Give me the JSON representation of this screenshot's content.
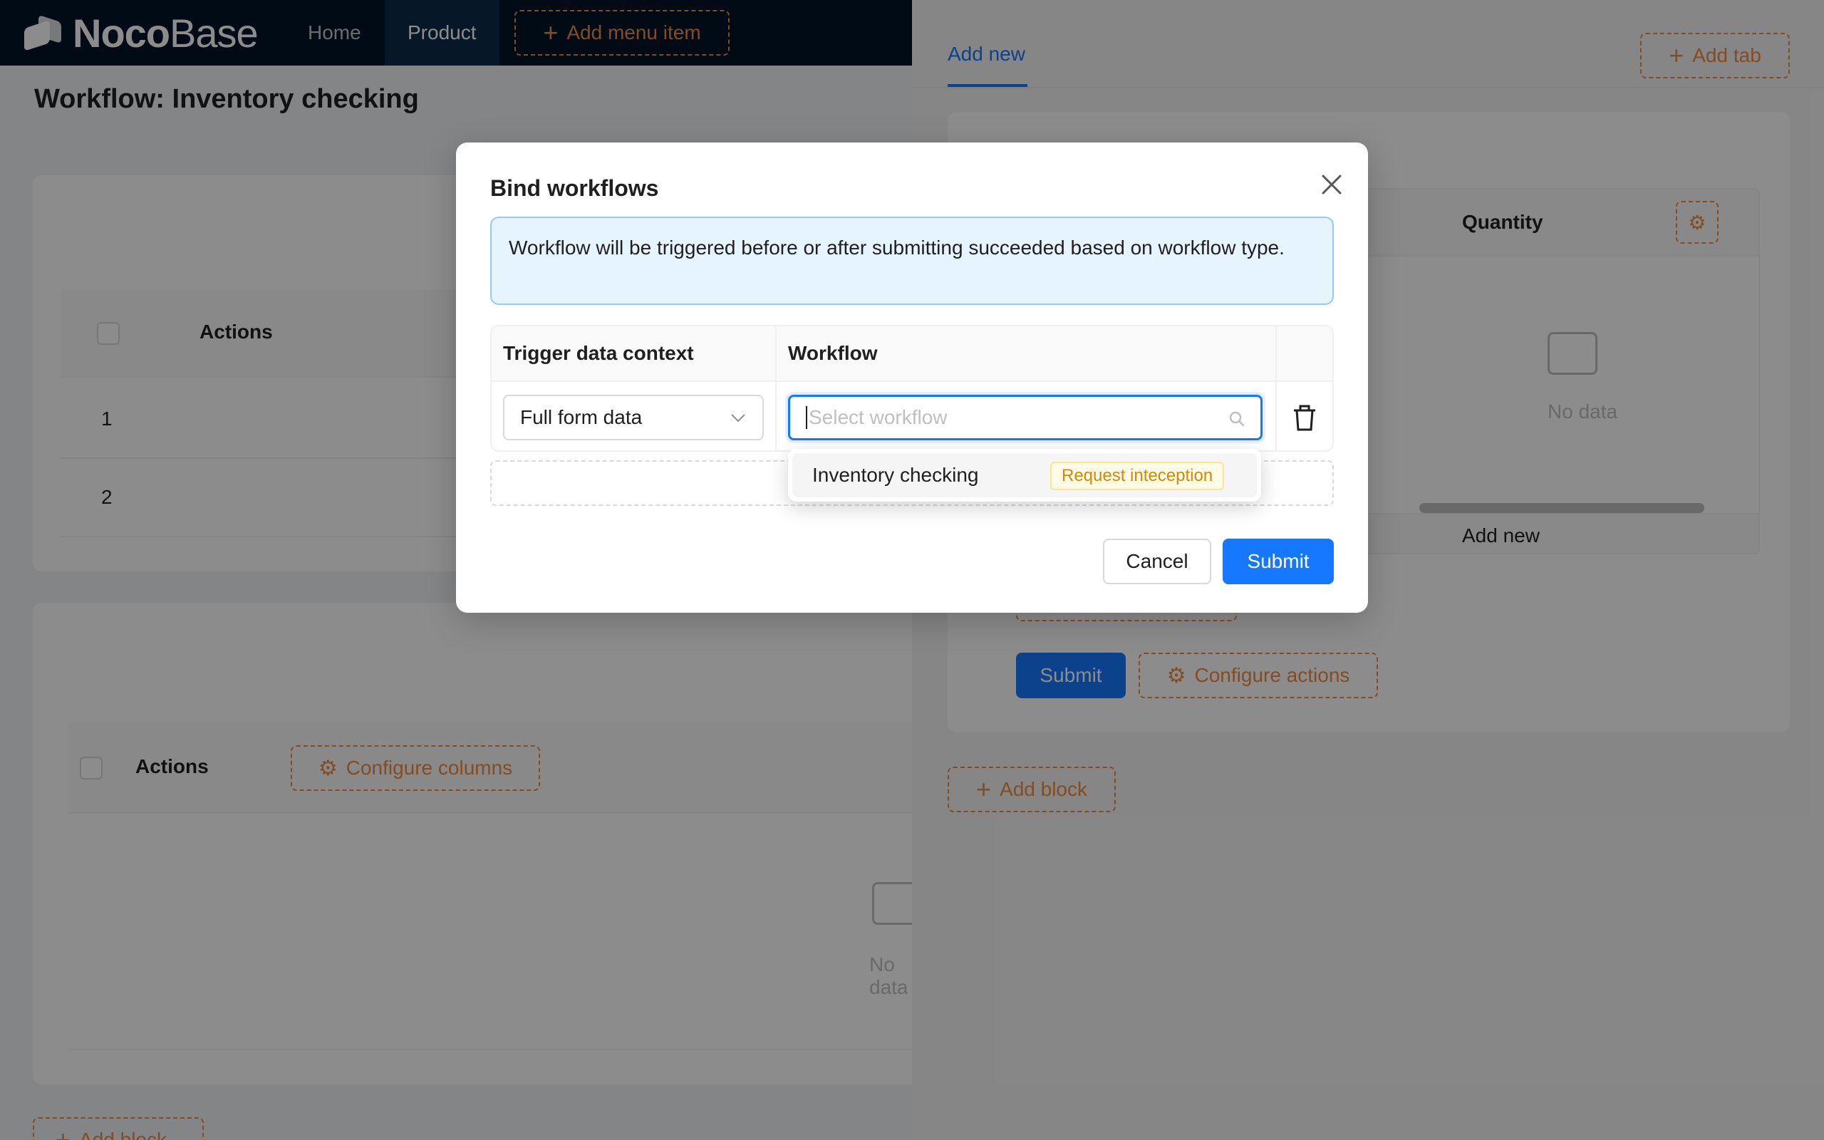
{
  "app": {
    "logo_bold": "Noco",
    "logo_light": "Base"
  },
  "nav": {
    "home": "Home",
    "product": "Product",
    "add_menu_item": "Add menu item"
  },
  "page": {
    "title": "Workflow: Inventory checking",
    "table1": {
      "actions_header": "Actions",
      "rows": [
        "1",
        "2"
      ]
    },
    "table2": {
      "actions_header": "Actions",
      "configure_columns": "Configure columns",
      "empty_text": "No data"
    },
    "add_block": "Add block"
  },
  "drawer": {
    "tab_add_new": "Add new",
    "add_tab": "Add tab",
    "inner_header": "Quantity",
    "inner_empty": "No data",
    "inner_footer": "Add new",
    "submit": "Submit",
    "configure_actions": "Configure actions",
    "add_block": "Add block"
  },
  "modal": {
    "title": "Bind workflows",
    "alert": "Workflow will be triggered before or after submitting succeeded based on workflow type.",
    "col_trigger": "Trigger data context",
    "col_workflow": "Workflow",
    "context_value": "Full form data",
    "workflow_placeholder": "Select workflow",
    "cancel": "Cancel",
    "submit": "Submit"
  },
  "dropdown": {
    "option_label": "Inventory checking",
    "option_tag": "Request inteception"
  },
  "colors": {
    "primary": "#1677ff",
    "accent_orange": "#f18b3d",
    "header_bg": "#001529",
    "tag_text": "#d48806"
  },
  "icons": [
    "logo-icon",
    "plus-icon",
    "gear-icon",
    "close-icon",
    "chevron-down-icon",
    "search-icon",
    "delete-icon",
    "empty-inbox-icon"
  ]
}
